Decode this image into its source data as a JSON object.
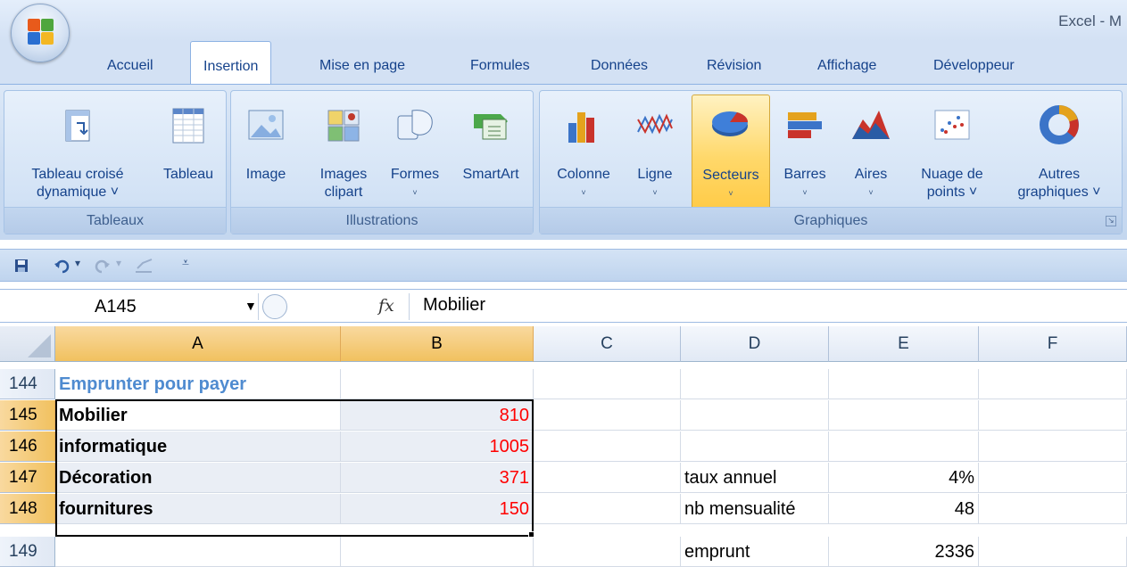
{
  "window": {
    "app_title": "Excel - M"
  },
  "ribbon_tabs": [
    {
      "label": "Accueil"
    },
    {
      "label": "Insertion"
    },
    {
      "label": "Mise en page"
    },
    {
      "label": "Formules"
    },
    {
      "label": "Données"
    },
    {
      "label": "Révision"
    },
    {
      "label": "Affichage"
    },
    {
      "label": "Développeur"
    }
  ],
  "active_tab": "Insertion",
  "groups": {
    "tableaux": {
      "label": "Tableaux",
      "buttons": [
        {
          "label_line1": "Tableau croisé",
          "label_line2": "dynamique ˅",
          "icon": "pivot-table-icon"
        },
        {
          "label_line1": "Tableau",
          "label_line2": "",
          "icon": "table-icon"
        }
      ]
    },
    "illustrations": {
      "label": "Illustrations",
      "buttons": [
        {
          "label_line1": "Image",
          "label_line2": "",
          "icon": "picture-icon"
        },
        {
          "label_line1": "Images",
          "label_line2": "clipart",
          "icon": "clipart-icon"
        },
        {
          "label_line1": "Formes",
          "label_line2": "˅",
          "icon": "shapes-icon"
        },
        {
          "label_line1": "SmartArt",
          "label_line2": "",
          "icon": "smartart-icon"
        }
      ]
    },
    "graphiques": {
      "label": "Graphiques",
      "buttons": [
        {
          "label_line1": "Colonne",
          "label_line2": "˅",
          "icon": "column-chart-icon"
        },
        {
          "label_line1": "Ligne",
          "label_line2": "˅",
          "icon": "line-chart-icon"
        },
        {
          "label_line1": "Secteurs",
          "label_line2": "˅",
          "icon": "pie-chart-icon"
        },
        {
          "label_line1": "Barres",
          "label_line2": "˅",
          "icon": "bar-chart-icon"
        },
        {
          "label_line1": "Aires",
          "label_line2": "˅",
          "icon": "area-chart-icon"
        },
        {
          "label_line1": "Nuage de",
          "label_line2": "points ˅",
          "icon": "scatter-chart-icon"
        },
        {
          "label_line1": "Autres",
          "label_line2": "graphiques ˅",
          "icon": "other-charts-icon"
        }
      ]
    }
  },
  "formula_bar": {
    "name_box": "A145",
    "fx_label": "fx",
    "content": "Mobilier"
  },
  "columns": [
    "A",
    "B",
    "C",
    "D",
    "E",
    "F"
  ],
  "rows": [
    {
      "num": "144",
      "A": "Emprunter pour payer",
      "B": "",
      "D": "",
      "E": ""
    },
    {
      "num": "145",
      "A": "Mobilier",
      "B": "810",
      "D": "",
      "E": ""
    },
    {
      "num": "146",
      "A": "informatique",
      "B": "1005",
      "D": "",
      "E": ""
    },
    {
      "num": "147",
      "A": "Décoration",
      "B": "371",
      "D": "taux annuel",
      "E": "4%"
    },
    {
      "num": "148",
      "A": "fournitures",
      "B": "150",
      "D": "nb mensualité",
      "E": "48"
    },
    {
      "num": "149",
      "A": "",
      "B": "",
      "D": "emprunt",
      "E": "2336"
    }
  ],
  "colors": {
    "ribbon_blue": "#c8daf1",
    "header_selected": "#f1c15f",
    "red_values": "#ff0000",
    "heading_blue": "#4f8bd0"
  }
}
